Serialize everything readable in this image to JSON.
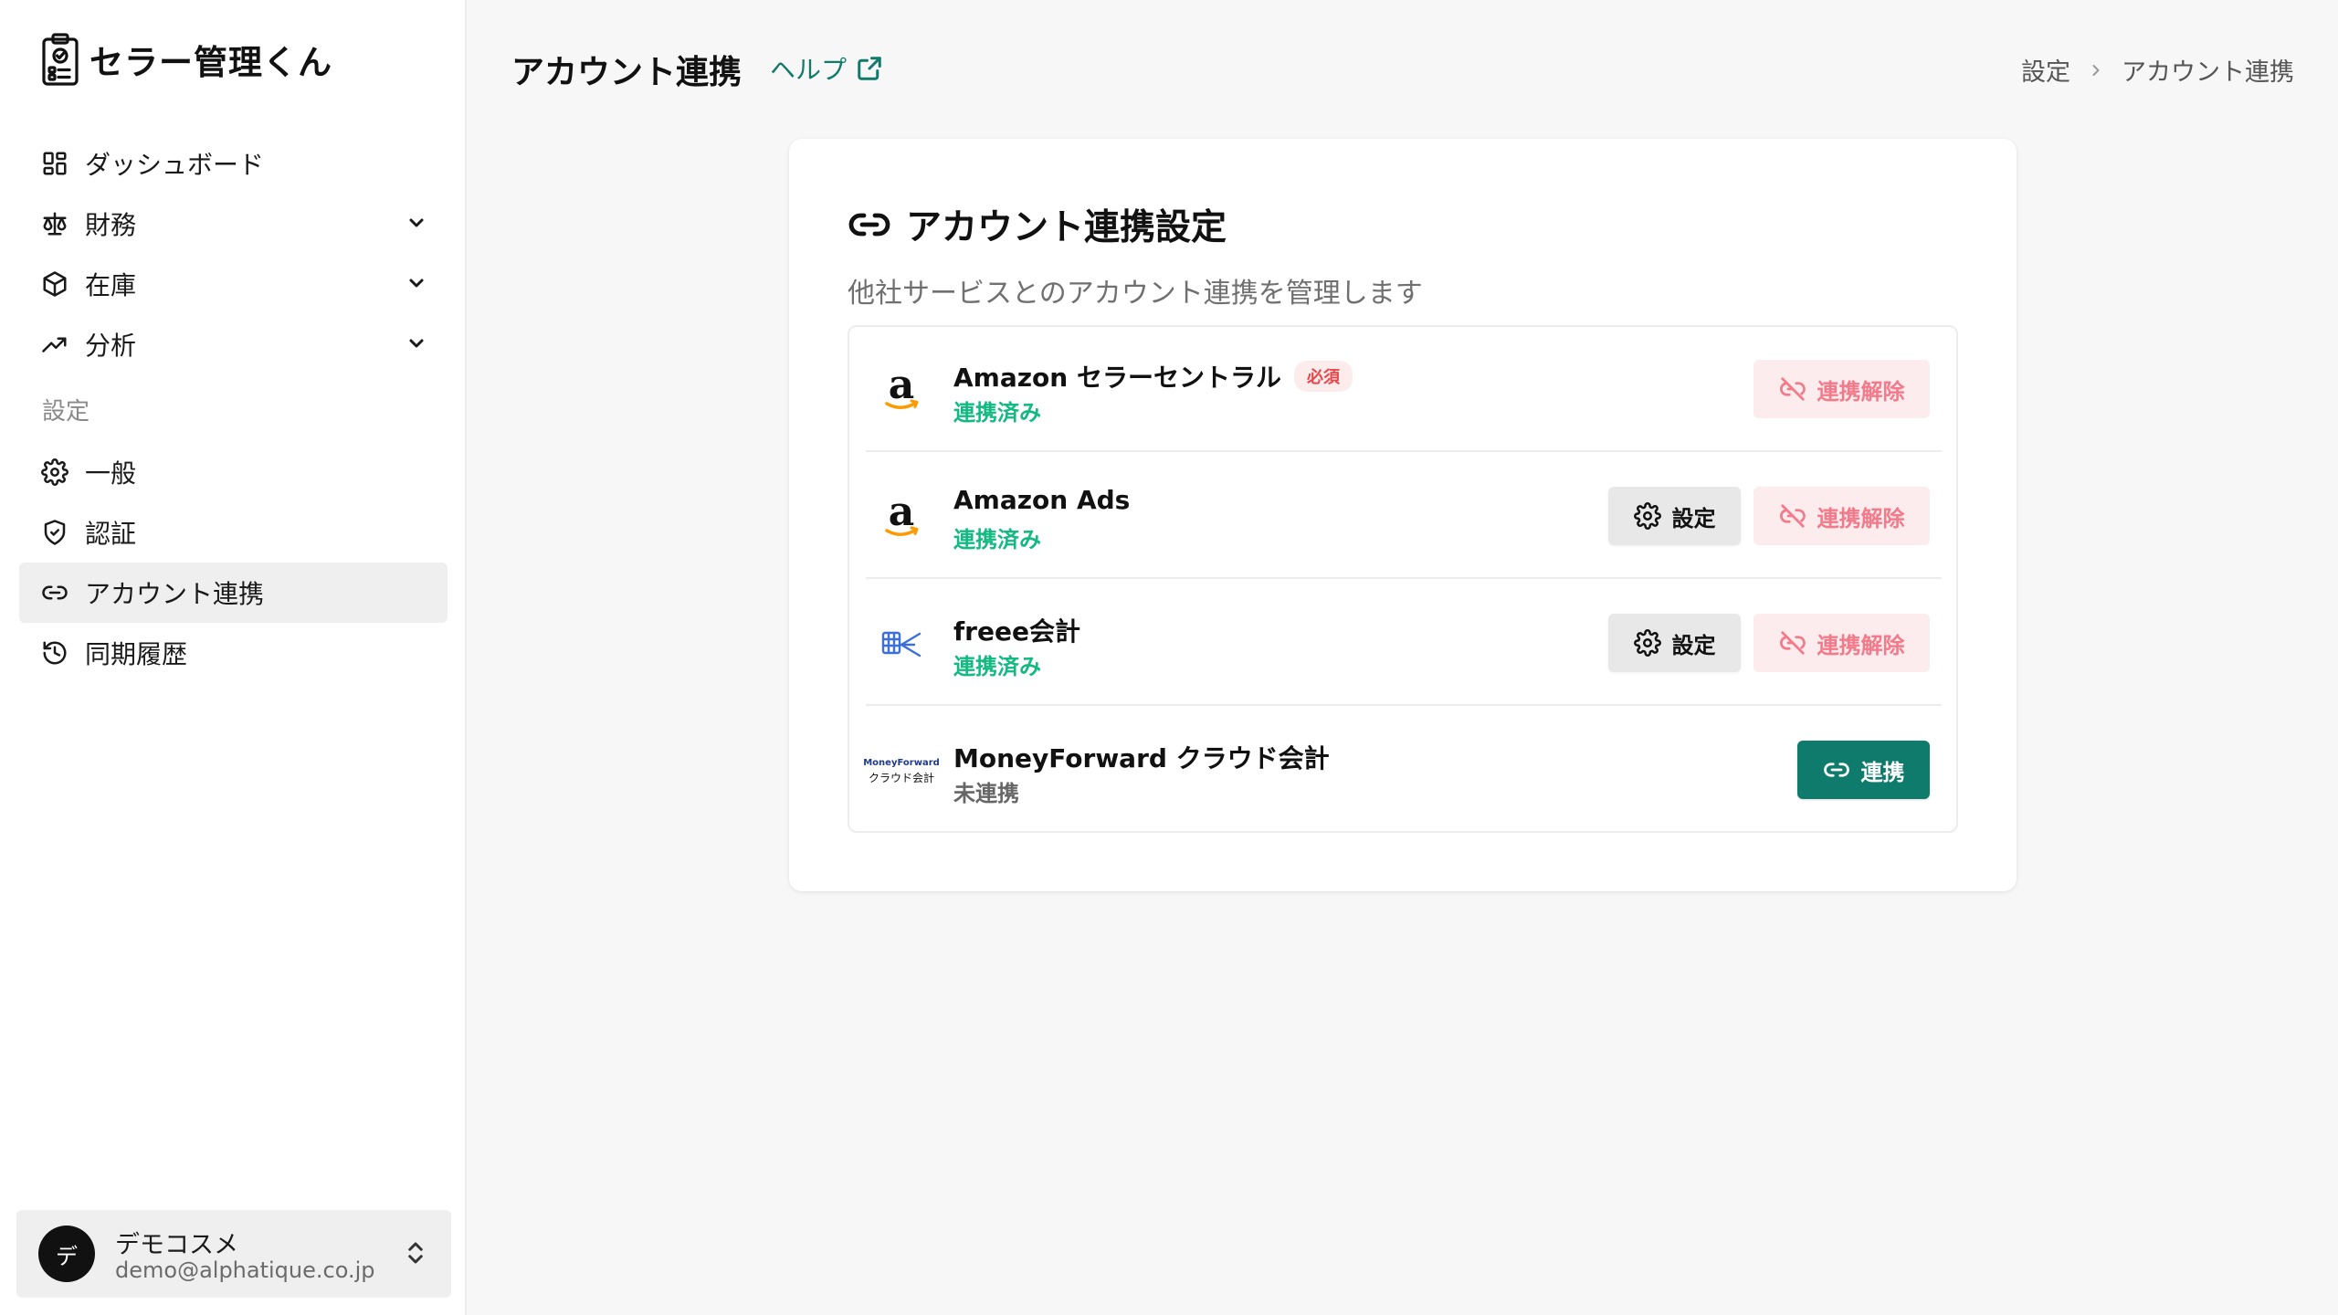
{
  "app": {
    "name": "セラー管理くん"
  },
  "sidebar": {
    "items": [
      {
        "label": "ダッシュボード",
        "icon": "dashboard-icon"
      },
      {
        "label": "財務",
        "icon": "scale-icon",
        "expandable": true
      },
      {
        "label": "在庫",
        "icon": "box-icon",
        "expandable": true
      },
      {
        "label": "分析",
        "icon": "trending-up-icon",
        "expandable": true
      }
    ],
    "section_label": "設定",
    "settings_items": [
      {
        "label": "一般",
        "icon": "gear-icon"
      },
      {
        "label": "認証",
        "icon": "shield-check-icon"
      },
      {
        "label": "アカウント連携",
        "icon": "link-icon",
        "active": true
      },
      {
        "label": "同期履歴",
        "icon": "history-icon"
      }
    ],
    "user": {
      "avatar_initial": "デ",
      "name": "デモコスメ",
      "email": "demo@alphatique.co.jp"
    }
  },
  "header": {
    "title": "アカウント連携",
    "help_label": "ヘルプ",
    "breadcrumb": [
      "設定",
      "アカウント連携"
    ]
  },
  "main": {
    "card_title": "アカウント連携設定",
    "card_description": "他社サービスとのアカウント連携を管理します",
    "integrations": [
      {
        "name": "Amazon セラーセントラル",
        "badge": "必須",
        "status": "連携済み",
        "logo": "amazon-logo",
        "unlink_label": "連携解除"
      },
      {
        "name": "Amazon Ads",
        "status": "連携済み",
        "logo": "amazon-logo",
        "settings_label": "設定",
        "unlink_label": "連携解除"
      },
      {
        "name": "freee会計",
        "status": "連携済み",
        "logo": "freee-logo",
        "settings_label": "設定",
        "unlink_label": "連携解除"
      },
      {
        "name": "MoneyForward クラウド会計",
        "status": "未連携",
        "logo": "moneyforward-logo",
        "logo_text": [
          "MoneyForward",
          "クラウド会計"
        ],
        "link_label": "連携"
      }
    ]
  },
  "colors": {
    "accent": "#0f7b6c",
    "connected": "#12b981",
    "danger_text": "#f27a8a",
    "danger_bg": "#fdecee",
    "amazon_orange": "#ff9900"
  }
}
